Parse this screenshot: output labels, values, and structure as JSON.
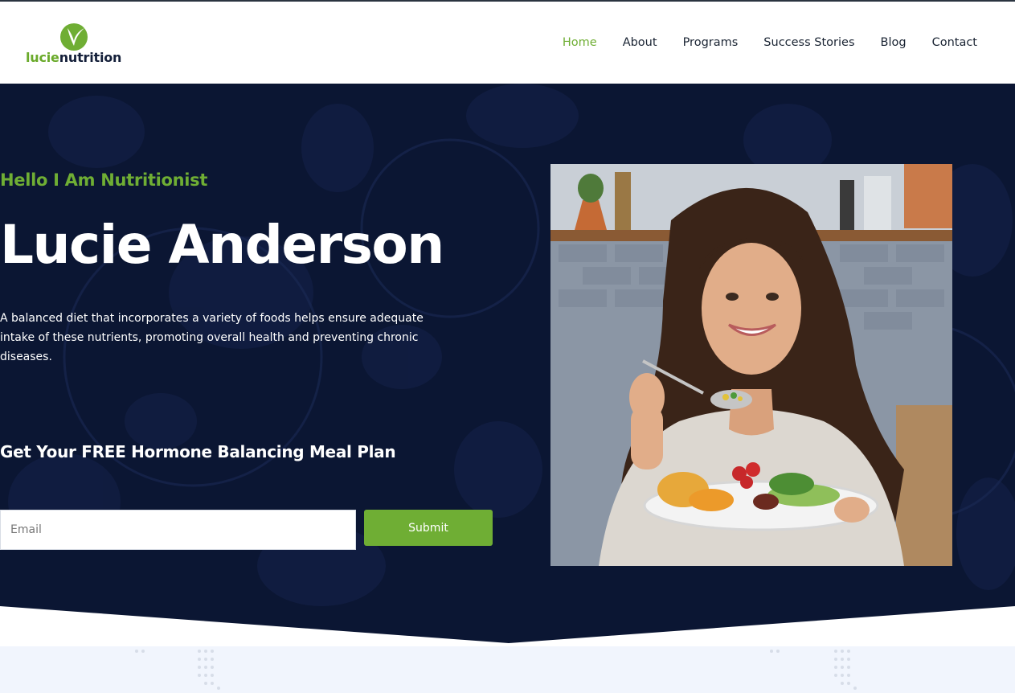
{
  "brand": {
    "part1": "lucie",
    "part2": "nutrition"
  },
  "nav": {
    "items": [
      {
        "label": "Home",
        "active": true
      },
      {
        "label": "About",
        "active": false
      },
      {
        "label": "Programs",
        "active": false
      },
      {
        "label": "Success Stories",
        "active": false
      },
      {
        "label": "Blog",
        "active": false
      },
      {
        "label": "Contact",
        "active": false
      }
    ]
  },
  "hero": {
    "greeting": "Hello I Am Nutritionist",
    "name": "Lucie Anderson",
    "description": "A balanced diet that incorporates a variety of foods helps ensure adequate intake of these nutrients, promoting overall health and preventing chronic diseases.",
    "cta_title": "Get Your FREE Hormone Balancing Meal Plan",
    "email_placeholder": "Email",
    "submit_label": "Submit"
  },
  "colors": {
    "accent": "#6fae34",
    "hero_bg": "#0b1633",
    "text_dark": "#1a2433"
  }
}
